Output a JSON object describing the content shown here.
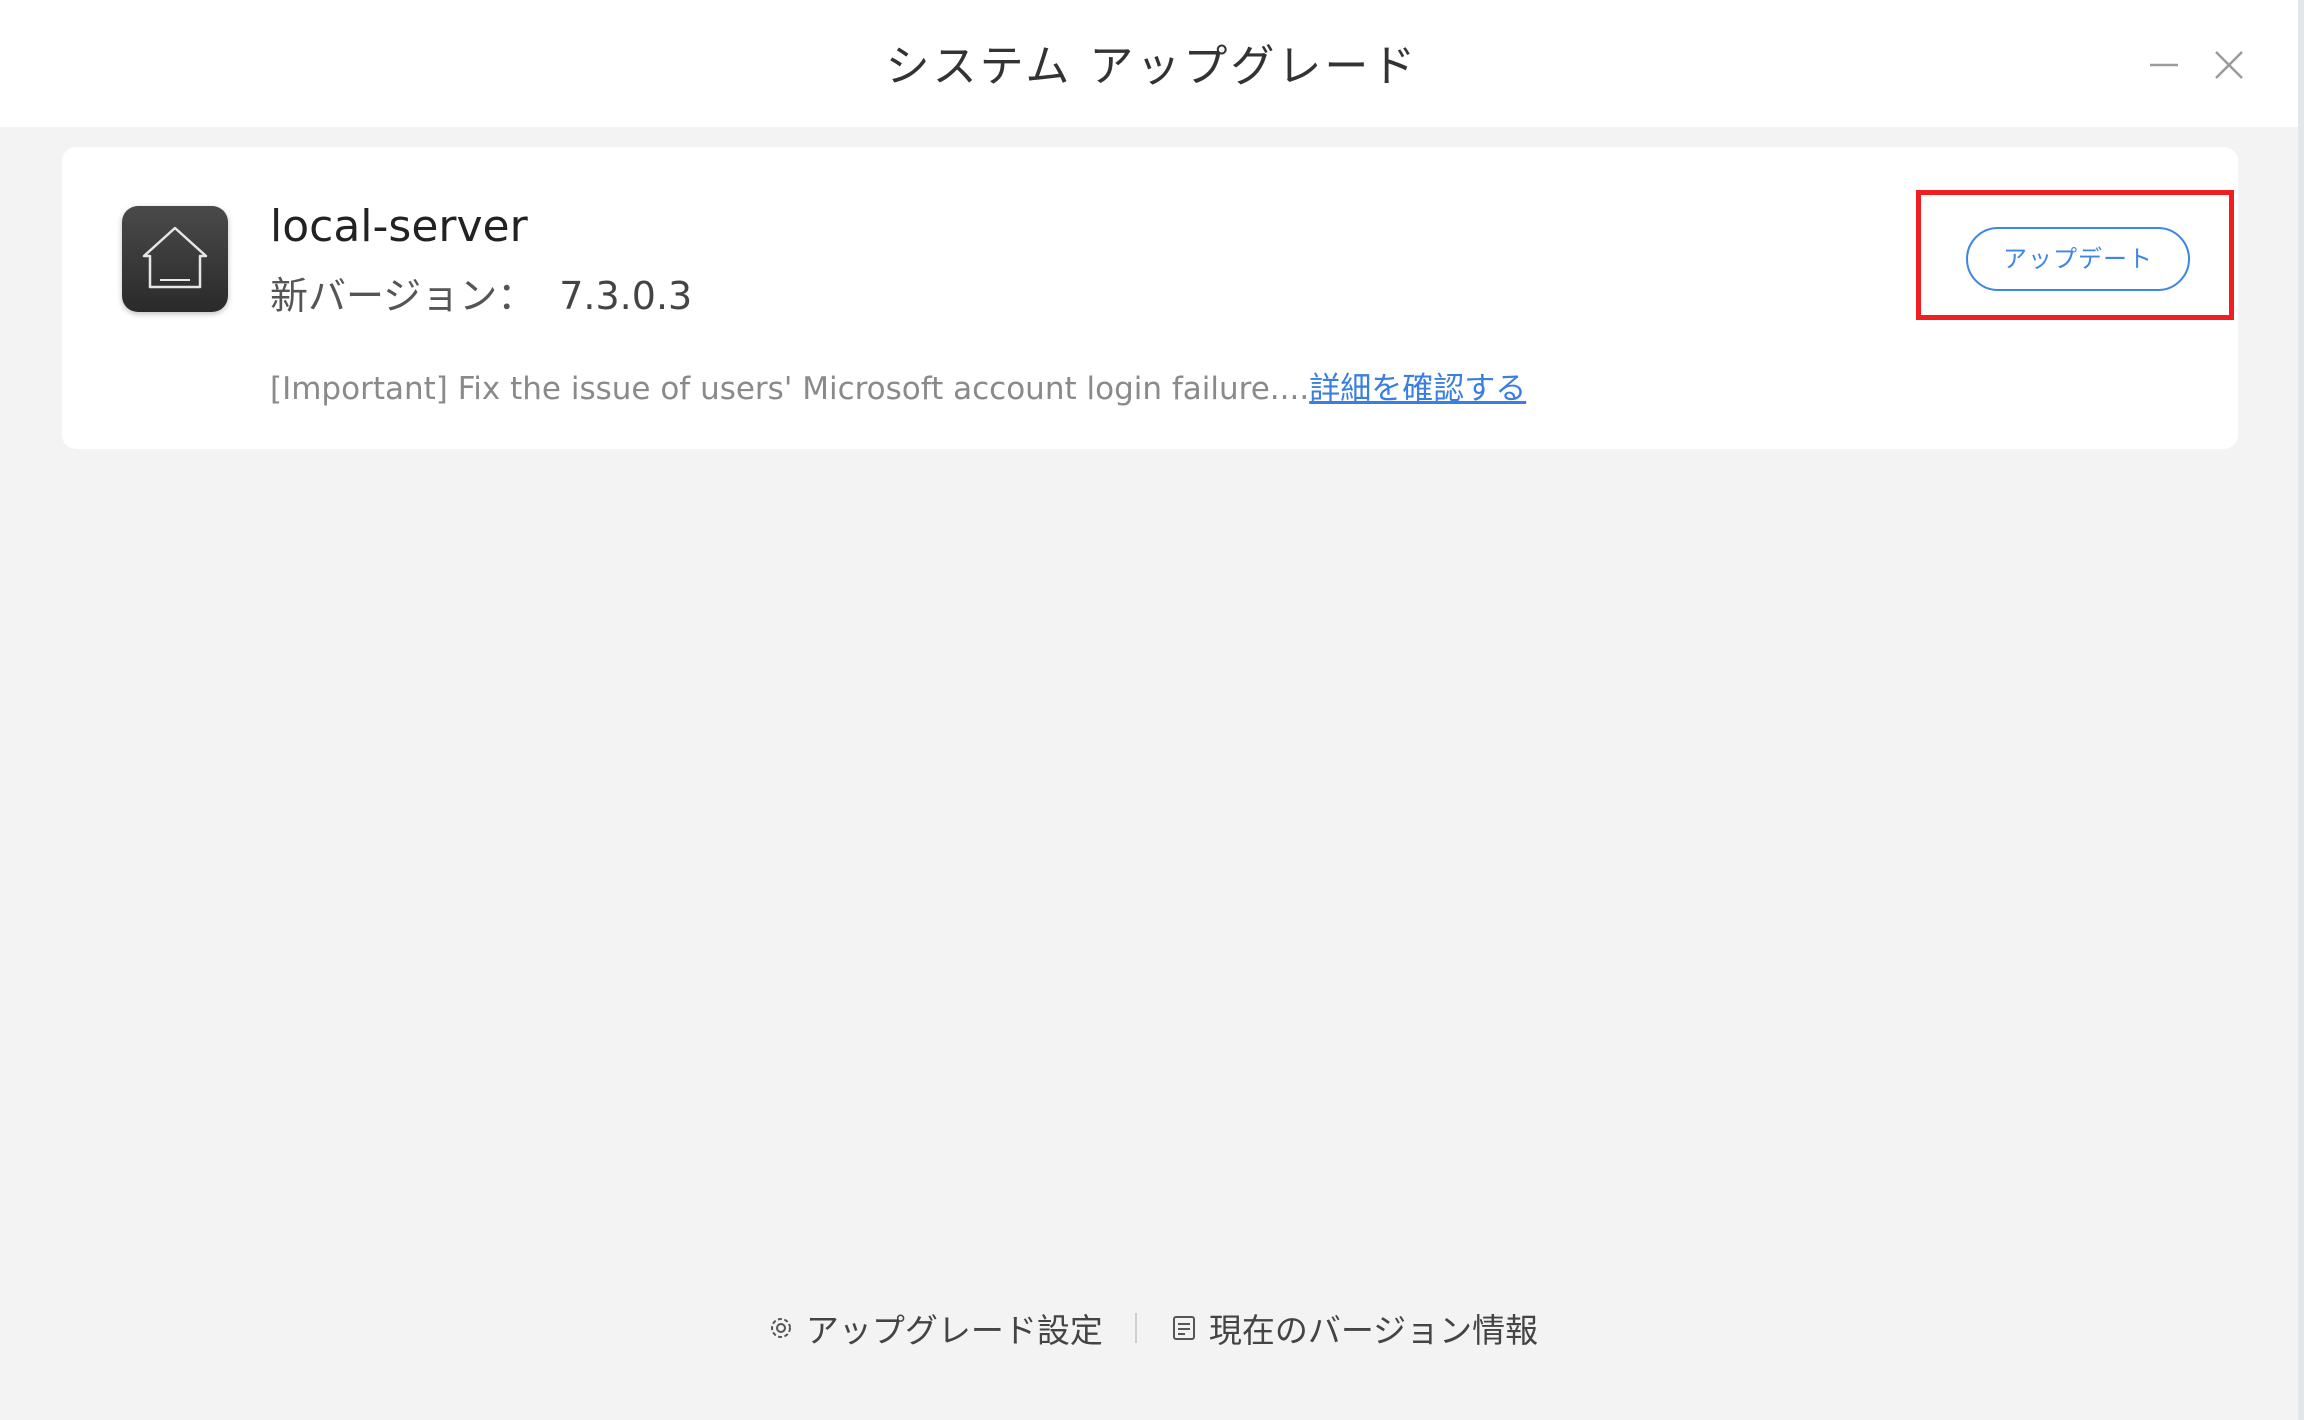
{
  "window": {
    "title": "システム アップグレード",
    "minimize_icon": "minimize-icon",
    "close_icon": "close-icon"
  },
  "update_card": {
    "app_icon": "home-icon",
    "app_name": "local-server",
    "version_label": "新バージョン：",
    "version_value": "7.3.0.3",
    "description": "[Important] Fix the issue of users' Microsoft account login failure....",
    "details_link": "詳細を確認する",
    "update_button": "アップデート"
  },
  "footer": {
    "settings_icon": "gear-icon",
    "settings_label": "アップグレード設定",
    "version_info_icon": "document-icon",
    "version_info_label": "現在のバージョン情報"
  },
  "colors": {
    "accent": "#3d86e6",
    "highlight": "#f01e1e",
    "background": "#f3f3f3"
  }
}
